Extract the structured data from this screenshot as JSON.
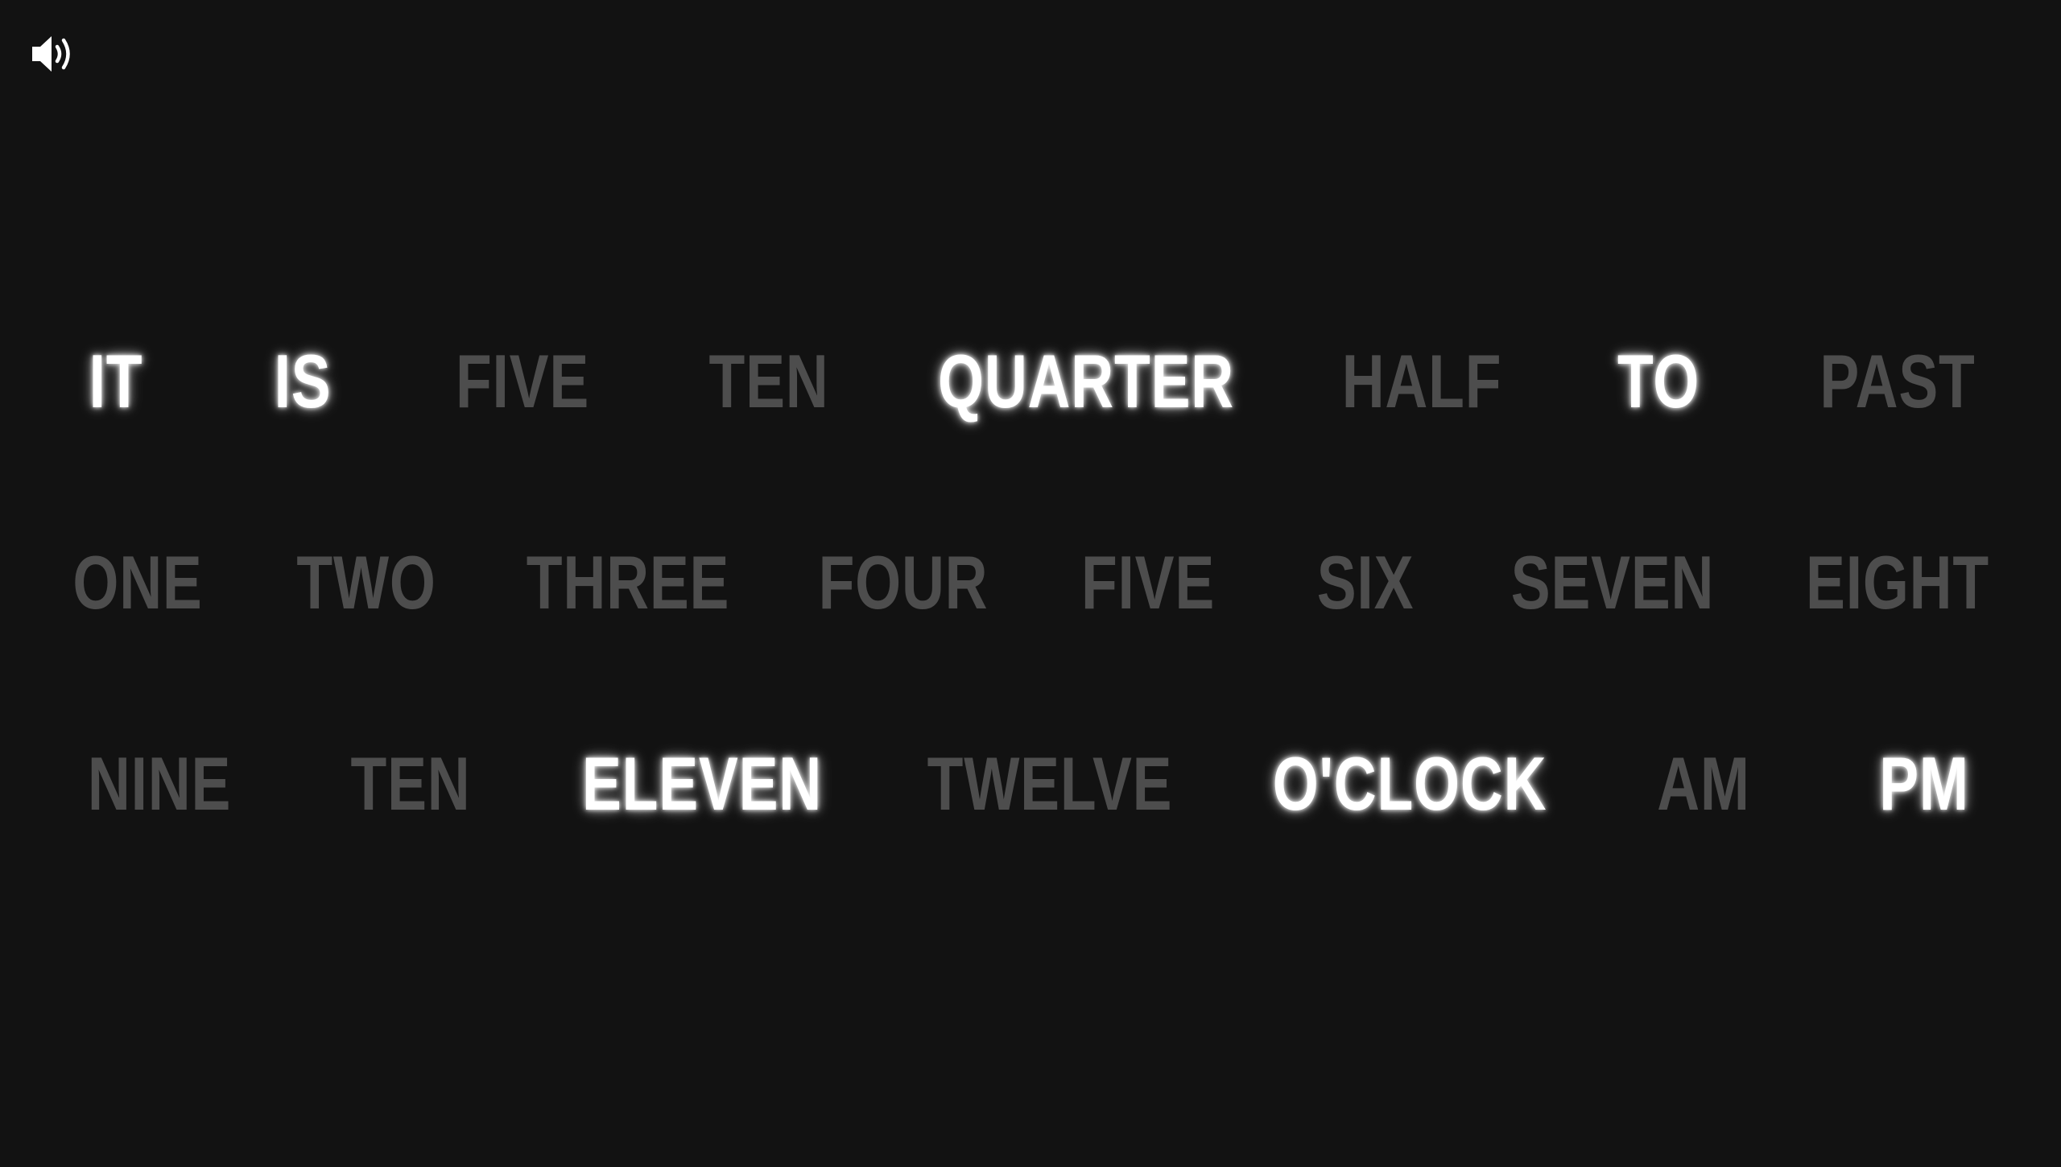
{
  "sound": {
    "icon": "speaker-volume-icon",
    "state": "on"
  },
  "colors": {
    "background": "#121212",
    "lit": "#ffffff",
    "dim": "#4d4d4d"
  },
  "clock": {
    "rows": [
      {
        "words": [
          {
            "text": "IT",
            "lit": true
          },
          {
            "text": "IS",
            "lit": true
          },
          {
            "text": "FIVE",
            "lit": false
          },
          {
            "text": "TEN",
            "lit": false
          },
          {
            "text": "QUARTER",
            "lit": true
          },
          {
            "text": "HALF",
            "lit": false
          },
          {
            "text": "TO",
            "lit": true
          },
          {
            "text": "PAST",
            "lit": false
          }
        ]
      },
      {
        "words": [
          {
            "text": "ONE",
            "lit": false
          },
          {
            "text": "TWO",
            "lit": false
          },
          {
            "text": "THREE",
            "lit": false
          },
          {
            "text": "FOUR",
            "lit": false
          },
          {
            "text": "FIVE",
            "lit": false
          },
          {
            "text": "SIX",
            "lit": false
          },
          {
            "text": "SEVEN",
            "lit": false
          },
          {
            "text": "EIGHT",
            "lit": false
          }
        ]
      },
      {
        "words": [
          {
            "text": "NINE",
            "lit": false
          },
          {
            "text": "TEN",
            "lit": false
          },
          {
            "text": "ELEVEN",
            "lit": true
          },
          {
            "text": "TWELVE",
            "lit": false
          },
          {
            "text": "O'CLOCK",
            "lit": true
          },
          {
            "text": "AM",
            "lit": false
          },
          {
            "text": "PM",
            "lit": true
          }
        ]
      }
    ]
  }
}
